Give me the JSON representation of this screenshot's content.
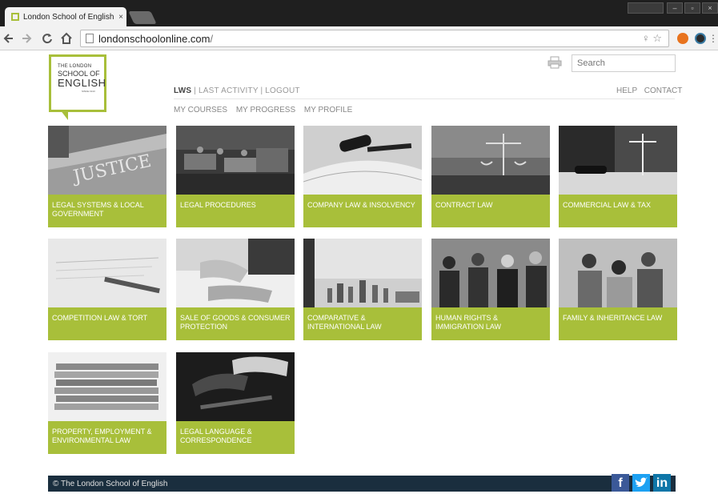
{
  "browser": {
    "tab_title": "London School of English",
    "tab_close": "×",
    "url_host": "londonschoolonline.com",
    "url_path": "/",
    "back_icon": "back-arrow-icon",
    "forward_icon": "forward-arrow-icon",
    "reload_icon": "reload-icon",
    "home_icon": "home-icon",
    "omnibox_right": "♀ ☆",
    "window_controls": [
      "–",
      "▫",
      "×"
    ]
  },
  "header": {
    "logo": {
      "line1": "THE LONDON",
      "line2": "SCHOOL OF",
      "line3": "ENGLISH",
      "line4": "SINCE 1913"
    },
    "search_placeholder": "Search",
    "links": {
      "lws": "LWS",
      "sep1": " | ",
      "last_activity": "LAST ACTIVITY",
      "sep2": " | ",
      "logout": "LOGOUT"
    },
    "help": "HELP",
    "contact": "CONTACT",
    "subnav": [
      "MY COURSES",
      "MY PROGRESS",
      "MY PROFILE"
    ]
  },
  "courses": [
    {
      "label": "LEGAL SYSTEMS & LOCAL GOVERNMENT"
    },
    {
      "label": "LEGAL PROCEDURES"
    },
    {
      "label": "COMPANY LAW & INSOLVENCY"
    },
    {
      "label": "CONTRACT LAW"
    },
    {
      "label": "COMMERCIAL LAW & TAX"
    },
    {
      "label": "COMPETITION LAW & TORT"
    },
    {
      "label": "SALE OF GOODS & CONSUMER PROTECTION"
    },
    {
      "label": "COMPARATIVE & INTERNATIONAL LAW"
    },
    {
      "label": "HUMAN RIGHTS & IMMIGRATION LAW"
    },
    {
      "label": "FAMILY & INHERITANCE LAW"
    },
    {
      "label": "PROPERTY, EMPLOYMENT & ENVIRONMENTAL LAW"
    },
    {
      "label": "LEGAL LANGUAGE & CORRESPONDENCE"
    }
  ],
  "tile_images": {
    "justice_text": "JUSTICE"
  },
  "footer": {
    "copyright": "© The London School of English",
    "social": [
      "f",
      "t",
      "in"
    ]
  },
  "colors": {
    "brand_green": "#a8bf3a",
    "footer_navy": "#1a2e3e",
    "facebook": "#3b5998",
    "twitter": "#1da1f2",
    "linkedin": "#0e76a8"
  }
}
